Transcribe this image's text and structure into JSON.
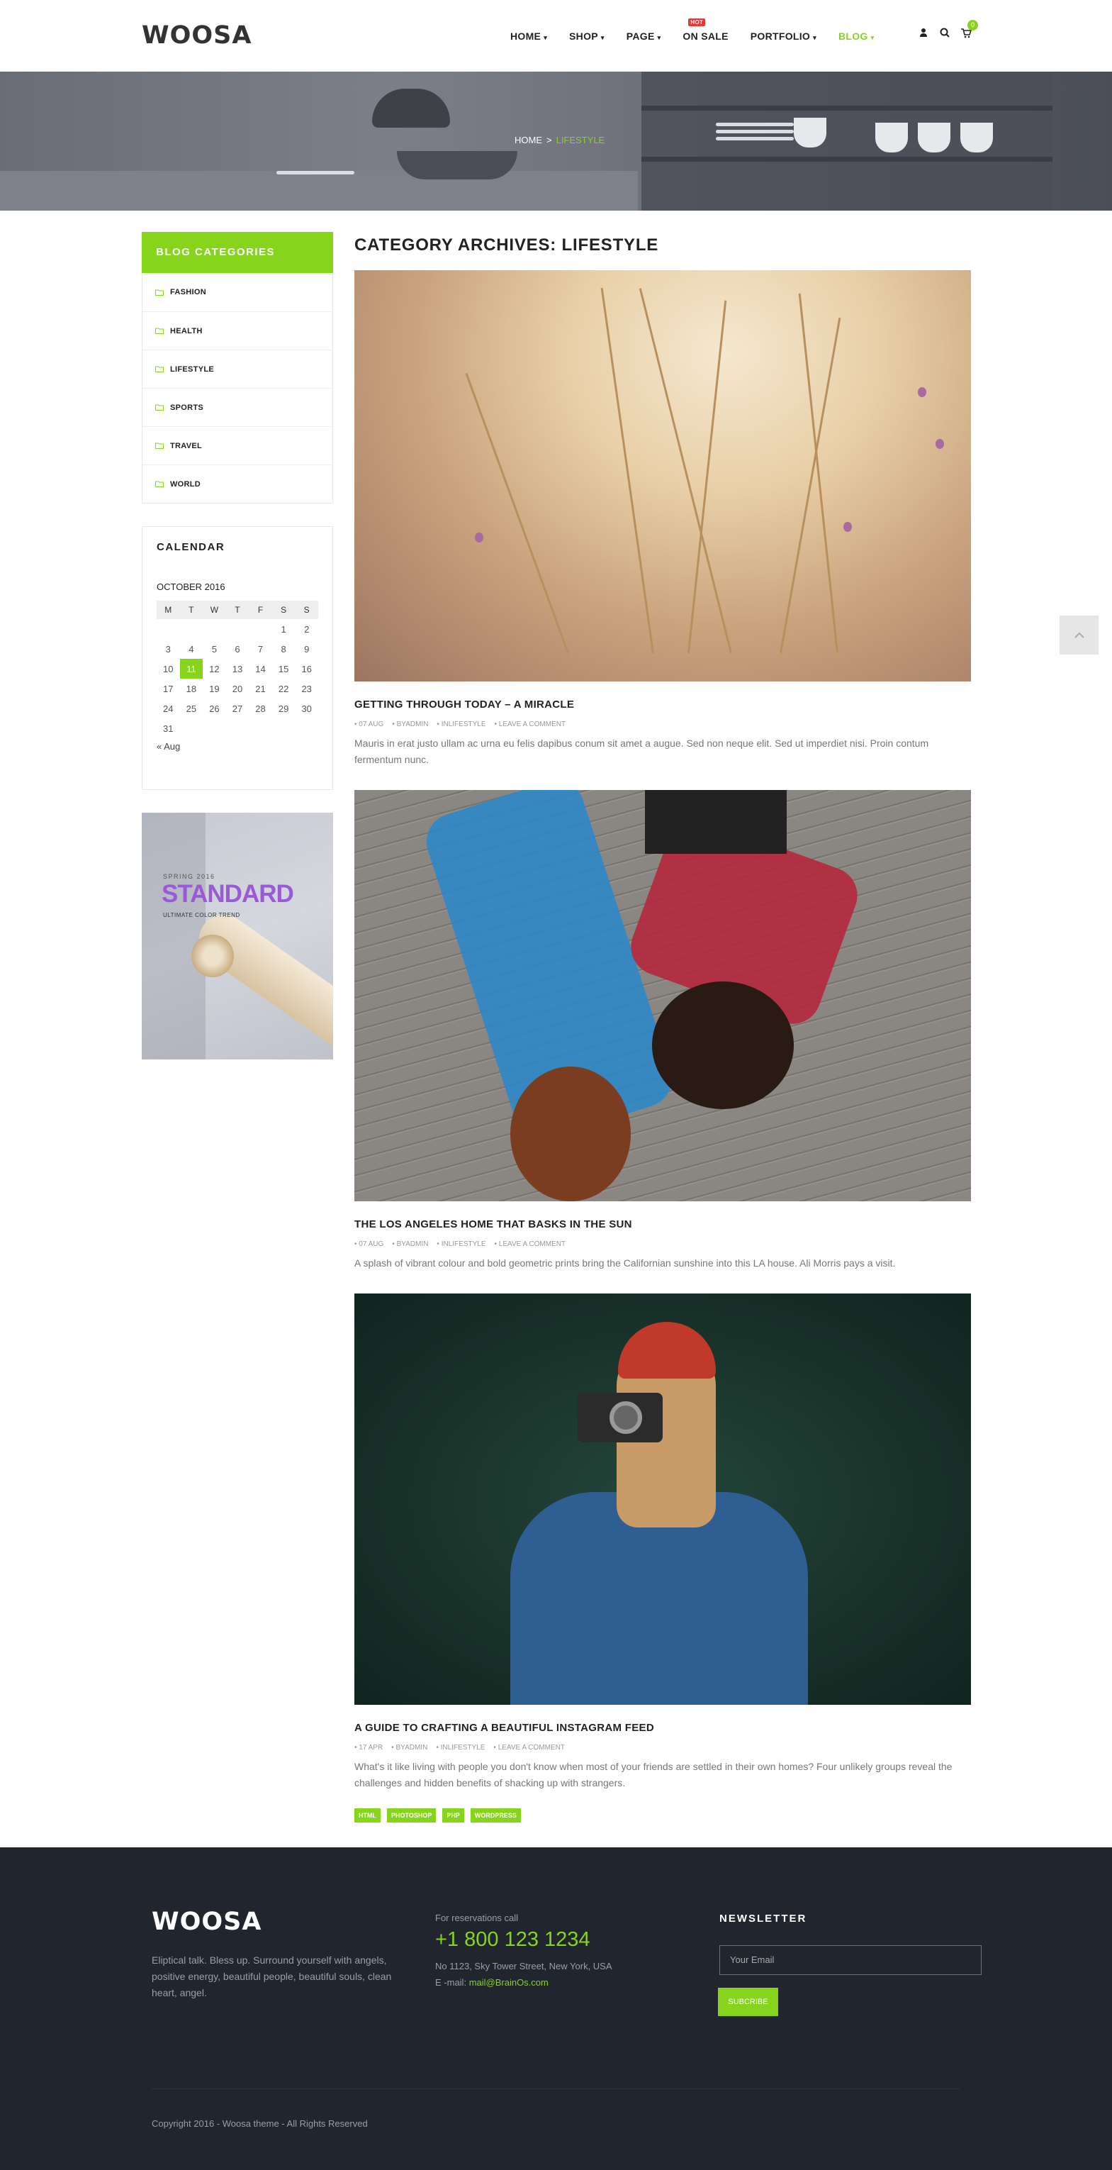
{
  "header": {
    "logo": "WOOSA",
    "nav": [
      {
        "label": "HOME",
        "caret": "▾"
      },
      {
        "label": "SHOP",
        "caret": "▾"
      },
      {
        "label": "PAGE",
        "caret": "▾"
      },
      {
        "label": "ON SALE",
        "badge": "HOT"
      },
      {
        "label": "PORTFOLIO",
        "caret": "▾"
      },
      {
        "label": "BLOG",
        "caret": "▾"
      }
    ],
    "cart_count": "0"
  },
  "breadcrumb": {
    "home": "HOME",
    "sep": ">",
    "current": "LIFESTYLE"
  },
  "sidebar": {
    "categories_title": "BLOG CATEGORIES",
    "categories": [
      "FASHION",
      "HEALTH",
      "LIFESTYLE",
      "SPORTS",
      "TRAVEL",
      "WORLD"
    ],
    "calendar": {
      "title": "CALENDAR",
      "month": "OCTOBER 2016",
      "weekdays": [
        "M",
        "T",
        "W",
        "T",
        "F",
        "S",
        "S"
      ],
      "weeks": [
        [
          "",
          "",
          "",
          "",
          "",
          "1",
          "2"
        ],
        [
          "3",
          "4",
          "5",
          "6",
          "7",
          "8",
          "9"
        ],
        [
          "10",
          "11",
          "12",
          "13",
          "14",
          "15",
          "16"
        ],
        [
          "17",
          "18",
          "19",
          "20",
          "21",
          "22",
          "23"
        ],
        [
          "24",
          "25",
          "26",
          "27",
          "28",
          "29",
          "30"
        ],
        [
          "31",
          "",
          "",
          "",
          "",
          "",
          ""
        ]
      ],
      "today": "11",
      "prev": "« Aug"
    },
    "promo": {
      "season": "SPRING 2016",
      "title": "STANDARD",
      "subtitle": "ULTIMATE COLOR TREND"
    }
  },
  "main": {
    "page_title": "CATEGORY ARCHIVES: LIFESTYLE",
    "posts": [
      {
        "title": "GETTING THROUGH TODAY – A MIRACLE",
        "date": "07 AUG",
        "author": "BYADMIN",
        "category": "INLIFESTYLE",
        "comments": "LEAVE A COMMENT",
        "excerpt": "Mauris in erat justo ullam ac urna eu felis dapibus conum sit amet a augue. Sed non neque elit. Sed ut imperdiet nisi. Proin contum fermentum nunc."
      },
      {
        "title": "THE LOS ANGELES HOME THAT BASKS IN THE SUN",
        "date": "07 AUG",
        "author": "BYADMIN",
        "category": "INLIFESTYLE",
        "comments": "LEAVE A COMMENT",
        "excerpt": "A splash of vibrant colour and bold geometric prints bring the Californian sunshine into this LA house. Ali Morris pays a visit."
      },
      {
        "title": "A GUIDE TO CRAFTING A BEAUTIFUL INSTAGRAM FEED",
        "date": "17 APR",
        "author": "BYADMIN",
        "category": "INLIFESTYLE",
        "comments": "LEAVE A COMMENT",
        "excerpt": "What's it like living with people you don't know when most of your friends are settled in their own homes? Four unlikely groups reveal the challenges and hidden benefits of shacking up with strangers."
      }
    ],
    "tags": [
      "HTML",
      "PHOTOSHOP",
      "PHP",
      "WORDPRESS"
    ]
  },
  "footer": {
    "logo": "WOOSA",
    "about": "Eliptical talk. Bless up. Surround yourself with angels, positive energy, beautiful people, beautiful souls, clean heart, angel.",
    "reservations_label": "For reservations call",
    "phone": "+1 800 123 1234",
    "address": "No 1123, Sky Tower Street, New York, USA",
    "email_label": "E -mail:",
    "email": "mail@BrainOs.com",
    "newsletter_title": "NEWSLETTER",
    "email_placeholder": "Your Email",
    "subscribe_label": "SUBCRIBE",
    "copyright": "Copyright 2016 - Woosa theme - All Rights Reserved"
  },
  "colors": {
    "accent": "#86d41b",
    "footer_bg": "#21252d",
    "hot_badge": "#e03b3b"
  },
  "icons": [
    "user-icon",
    "search-icon",
    "cart-icon",
    "folder-icon",
    "chevron-up-icon"
  ]
}
